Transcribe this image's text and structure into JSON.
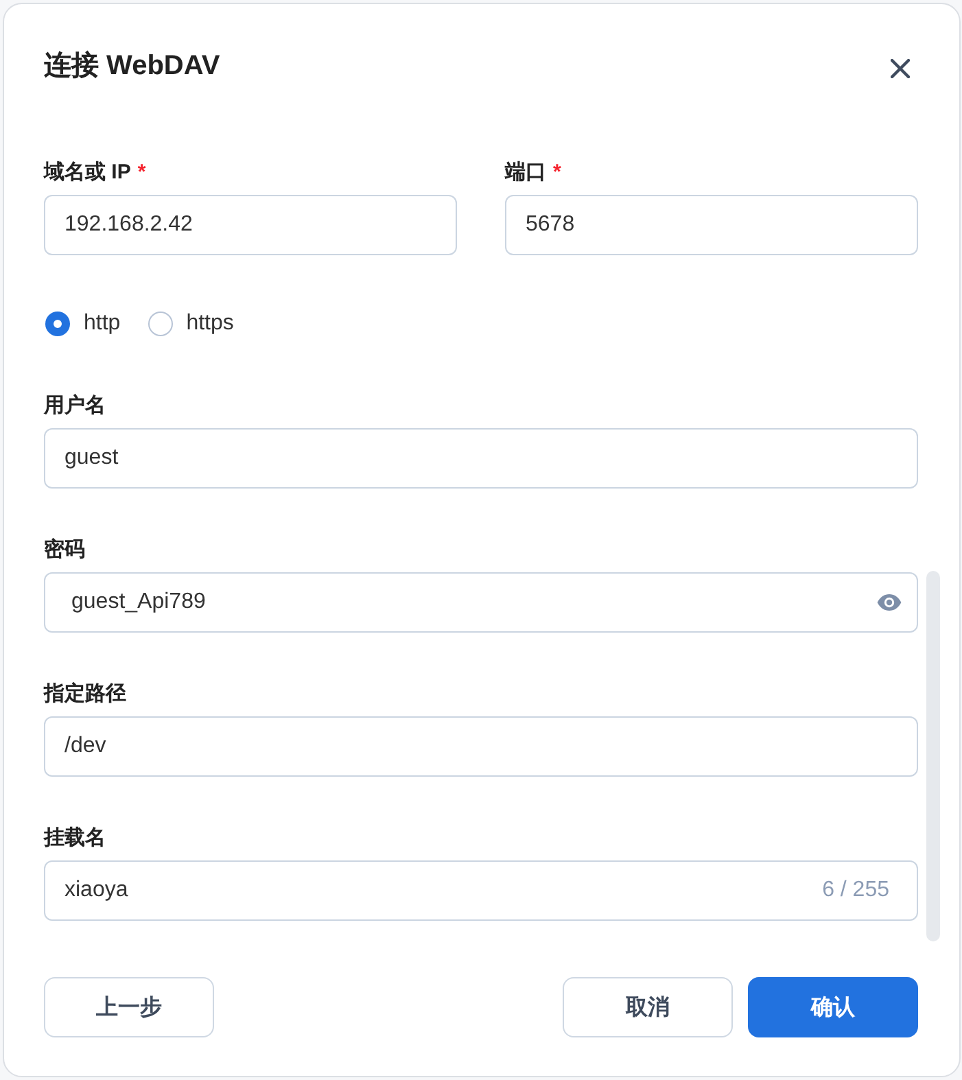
{
  "dialog": {
    "title": "连接 WebDAV"
  },
  "server_fields": [
    {
      "label": "域名或 IP",
      "required_mark": "*",
      "value": "192.168.2.42",
      "kind": "text"
    },
    {
      "label": "端口",
      "required_mark": "*",
      "value": "5678",
      "kind": "text"
    }
  ],
  "protocol": [
    {
      "label": "http",
      "selected": true
    },
    {
      "label": "https",
      "selected": false
    }
  ],
  "fields": [
    {
      "label": "用户名",
      "value": "guest",
      "kind": "text"
    },
    {
      "label": "密码",
      "value": "guest_Api789",
      "kind": "password"
    },
    {
      "label": "指定路径",
      "value": "/dev",
      "kind": "text"
    },
    {
      "label": "挂载名",
      "value": "xiaoya",
      "kind": "text",
      "counter": "6 / 255"
    }
  ],
  "footer": {
    "left_buttons": [
      {
        "label": "上一步",
        "kind": "secondary"
      }
    ],
    "right_buttons": [
      {
        "label": "取消",
        "kind": "secondary"
      },
      {
        "label": "确认",
        "kind": "primary"
      }
    ]
  }
}
